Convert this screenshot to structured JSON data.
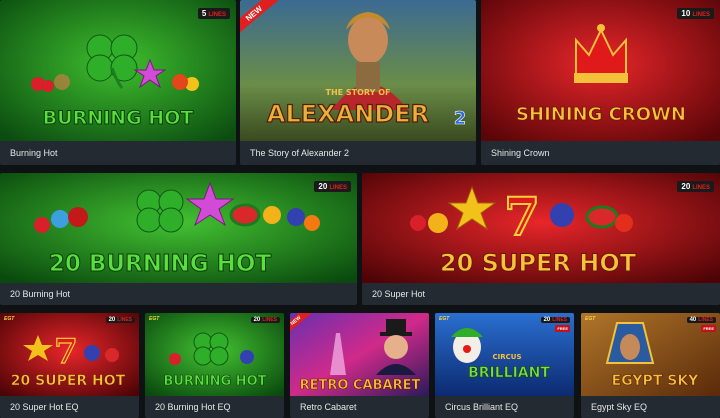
{
  "games": [
    {
      "title": "Burning Hot",
      "lines": "5",
      "badge_suffix": "LINES",
      "logo": "BURNING HOT",
      "new": false
    },
    {
      "title": "The Story of Alexander 2",
      "lines": "",
      "badge_suffix": "",
      "logo": "ALEXANDER",
      "logo_top": "THE STORY OF",
      "logo_num": "2",
      "new": true,
      "new_label": "NEW"
    },
    {
      "title": "Shining Crown",
      "lines": "10",
      "badge_suffix": "LINES",
      "logo": "SHINING CROWN",
      "new": false
    },
    {
      "title": "20 Burning Hot",
      "lines": "20",
      "badge_suffix": "LINES",
      "logo": "20 BURNING HOT",
      "new": false
    },
    {
      "title": "20 Super Hot",
      "lines": "20",
      "badge_suffix": "LINES",
      "logo": "20 SUPER HOT",
      "new": false
    },
    {
      "title": "20 Super Hot EQ",
      "lines": "20",
      "badge_suffix": "LINES",
      "logo": "20 SUPER HOT",
      "new": false,
      "provider": "EGT"
    },
    {
      "title": "20 Burning Hot EQ",
      "lines": "20",
      "badge_suffix": "LINES",
      "logo": "BURNING HOT",
      "new": false,
      "provider": "EGT"
    },
    {
      "title": "Retro Cabaret",
      "lines": "",
      "badge_suffix": "",
      "logo": "RETRO CABARET",
      "new": true,
      "new_label": "NEW"
    },
    {
      "title": "Circus Brilliant EQ",
      "lines": "20",
      "badge_suffix": "LINES",
      "logo": "BRILLIANT",
      "logo_top": "CIRCUS",
      "new": false,
      "provider": "EGT",
      "free_label": "FREE"
    },
    {
      "title": "Egypt Sky EQ",
      "lines": "40",
      "badge_suffix": "LINES",
      "logo": "EGYPT SKY",
      "new": false,
      "provider": "EGT",
      "free_label": "FREE"
    }
  ],
  "colors": {
    "page_bg": "#0f1215",
    "caption_bg": "#232a31",
    "caption_text": "#e6e8ea",
    "green": "#1b8f1e",
    "red": "#b3080c",
    "badge_red": "#e02020"
  },
  "icons": [
    "clover-icon",
    "star-icon",
    "seven-icon",
    "cherry-icon",
    "grape-icon",
    "watermelon-icon",
    "lemon-icon",
    "crown-icon",
    "clown-icon",
    "pharaoh-icon",
    "eiffel-tower-icon",
    "alexander-portrait-icon"
  ]
}
